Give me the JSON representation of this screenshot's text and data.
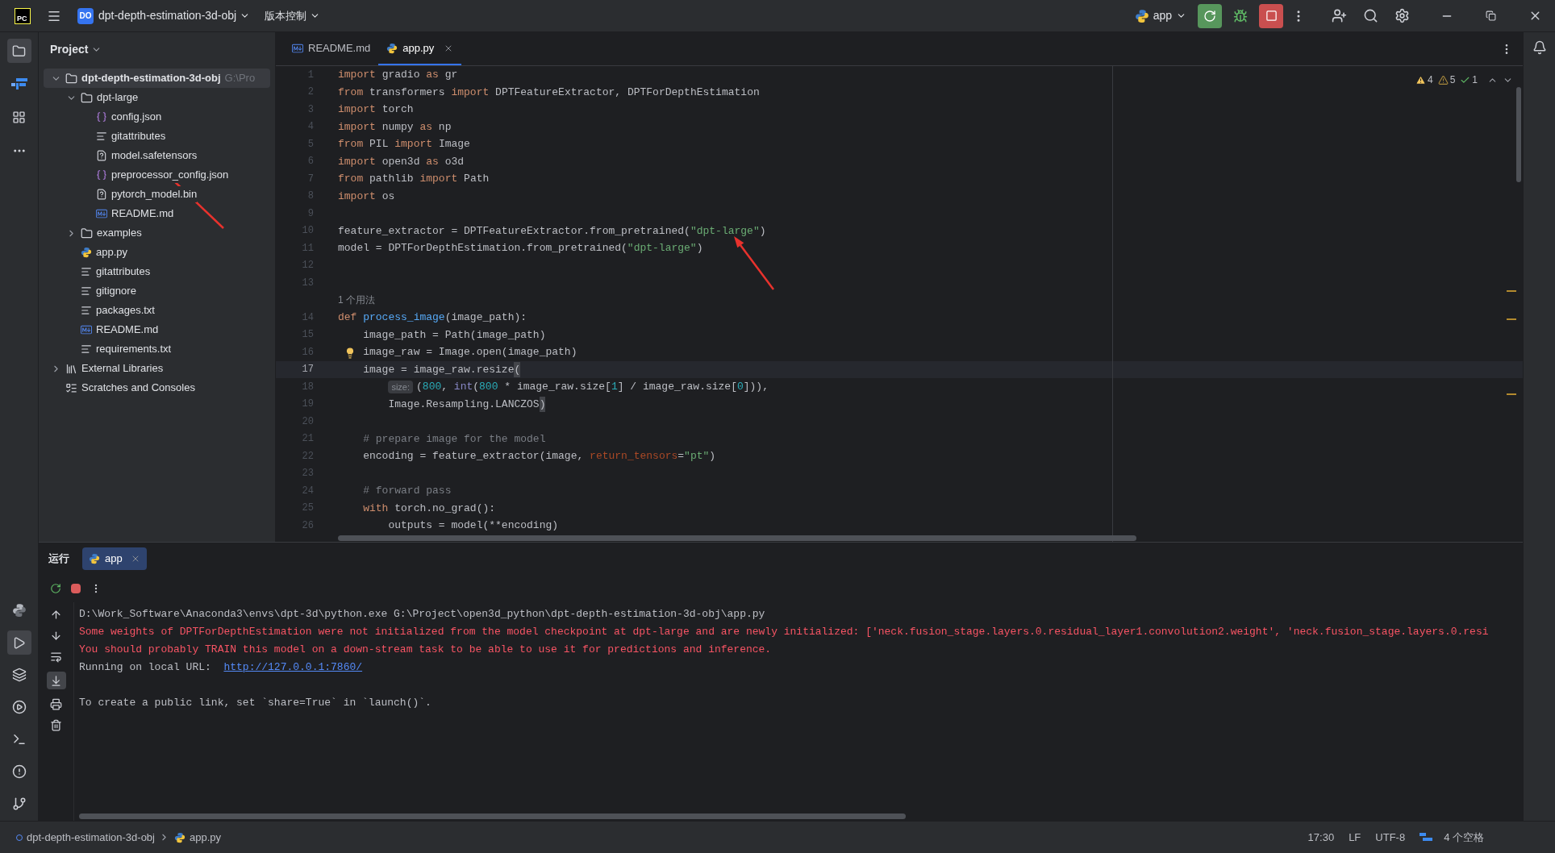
{
  "title_bar": {
    "logo": "PC",
    "project_badge": "DO",
    "project": "dpt-depth-estimation-3d-obj",
    "vcs": "版本控制",
    "run_config": "app"
  },
  "project_panel": {
    "title": "Project",
    "tree": [
      {
        "kind": "folder",
        "name": "dpt-depth-estimation-3d-obj",
        "path": "G:\\Pro",
        "expanded": true,
        "selected": true,
        "children": [
          {
            "kind": "folder",
            "name": "dpt-large",
            "expanded": true,
            "selected": false,
            "children": [
              {
                "kind": "json",
                "name": "config.json",
                "selected": false
              },
              {
                "kind": "text",
                "name": "gitattributes",
                "selected": false
              },
              {
                "kind": "unknown",
                "name": "model.safetensors",
                "selected": false
              },
              {
                "kind": "json",
                "name": "preprocessor_config.json",
                "selected": false
              },
              {
                "kind": "unknown",
                "name": "pytorch_model.bin",
                "selected": false
              },
              {
                "kind": "markdown",
                "name": "README.md",
                "selected": false
              }
            ]
          },
          {
            "kind": "folder",
            "name": "examples",
            "expanded": false,
            "selected": false
          },
          {
            "kind": "python",
            "name": "app.py",
            "selected": false
          },
          {
            "kind": "text",
            "name": "gitattributes",
            "selected": false
          },
          {
            "kind": "text",
            "name": "gitignore",
            "selected": false
          },
          {
            "kind": "text",
            "name": "packages.txt",
            "selected": false
          },
          {
            "kind": "markdown",
            "name": "README.md",
            "selected": false
          },
          {
            "kind": "text",
            "name": "requirements.txt",
            "selected": false
          }
        ]
      },
      {
        "kind": "libraries",
        "name": "External Libraries",
        "expanded": false,
        "selected": false
      },
      {
        "kind": "scratches",
        "name": "Scratches and Consoles",
        "selected": false
      }
    ]
  },
  "editor": {
    "tabs": [
      {
        "kind": "markdown",
        "label": "README.md",
        "selected": false
      },
      {
        "kind": "python",
        "label": "app.py",
        "selected": true
      }
    ],
    "inspections": [
      {
        "kind": "warning",
        "count": "4"
      },
      {
        "kind": "weak",
        "count": "5"
      },
      {
        "kind": "ok",
        "count": "1"
      }
    ],
    "lines": [
      {
        "kind": "code",
        "number": "1",
        "current": false,
        "tokens": [
          {
            "kind": "kw",
            "text": "import"
          },
          {
            "kind": "plain",
            "text": " gradio "
          },
          {
            "kind": "kw",
            "text": "as"
          },
          {
            "kind": "plain",
            "text": " gr"
          }
        ]
      },
      {
        "kind": "code",
        "number": "2",
        "current": false,
        "tokens": [
          {
            "kind": "kw",
            "text": "from"
          },
          {
            "kind": "plain",
            "text": " transformers "
          },
          {
            "kind": "kw",
            "text": "import"
          },
          {
            "kind": "plain",
            "text": " DPTFeatureExtractor, DPTForDepthEstimation"
          }
        ]
      },
      {
        "kind": "code",
        "number": "3",
        "current": false,
        "tokens": [
          {
            "kind": "kw",
            "text": "import"
          },
          {
            "kind": "plain",
            "text": " torch"
          }
        ]
      },
      {
        "kind": "code",
        "number": "4",
        "current": false,
        "tokens": [
          {
            "kind": "kw",
            "text": "import"
          },
          {
            "kind": "plain",
            "text": " numpy "
          },
          {
            "kind": "kw",
            "text": "as"
          },
          {
            "kind": "plain",
            "text": " np"
          }
        ]
      },
      {
        "kind": "code",
        "number": "5",
        "current": false,
        "tokens": [
          {
            "kind": "kw",
            "text": "from"
          },
          {
            "kind": "plain",
            "text": " PIL "
          },
          {
            "kind": "kw",
            "text": "import"
          },
          {
            "kind": "plain",
            "text": " Image"
          }
        ]
      },
      {
        "kind": "code",
        "number": "6",
        "current": false,
        "tokens": [
          {
            "kind": "kw",
            "text": "import"
          },
          {
            "kind": "plain",
            "text": " open3d "
          },
          {
            "kind": "kw",
            "text": "as"
          },
          {
            "kind": "plain",
            "text": " o3d"
          }
        ]
      },
      {
        "kind": "code",
        "number": "7",
        "current": false,
        "tokens": [
          {
            "kind": "kw",
            "text": "from"
          },
          {
            "kind": "plain",
            "text": " pathlib "
          },
          {
            "kind": "kw",
            "text": "import"
          },
          {
            "kind": "plain",
            "text": " Path"
          }
        ]
      },
      {
        "kind": "code",
        "number": "8",
        "current": false,
        "tokens": [
          {
            "kind": "kw",
            "text": "import"
          },
          {
            "kind": "plain",
            "text": " os"
          }
        ]
      },
      {
        "kind": "code",
        "number": "9",
        "current": false
      },
      {
        "kind": "code",
        "number": "10",
        "current": false,
        "tokens": [
          {
            "kind": "plain",
            "text": "feature_extractor = DPTFeatureExtractor.from_pretrained("
          },
          {
            "kind": "str",
            "text": "\"dpt-large\""
          },
          {
            "kind": "plain",
            "text": ")"
          }
        ]
      },
      {
        "kind": "code",
        "number": "11",
        "current": false,
        "tokens": [
          {
            "kind": "plain",
            "text": "model = DPTForDepthEstimation.from_pretrained("
          },
          {
            "kind": "str",
            "text": "\"dpt-large\""
          },
          {
            "kind": "plain",
            "text": ")"
          }
        ]
      },
      {
        "kind": "code",
        "number": "12",
        "current": false
      },
      {
        "kind": "code",
        "number": "13",
        "current": false
      },
      {
        "kind": "usage",
        "text": "1 个用法"
      },
      {
        "kind": "code",
        "number": "14",
        "current": false,
        "tokens": [
          {
            "kind": "kw",
            "text": "def "
          },
          {
            "kind": "fn",
            "text": "process_image"
          },
          {
            "kind": "plain",
            "text": "(image_path):"
          }
        ]
      },
      {
        "kind": "code",
        "number": "15",
        "current": false,
        "tokens": [
          {
            "kind": "plain",
            "text": "    image_path = Path(image_path)"
          }
        ]
      },
      {
        "kind": "code",
        "number": "16",
        "current": false,
        "bulb": true,
        "tokens": [
          {
            "kind": "plain",
            "text": "    image_raw = Image.open(image_path)"
          }
        ]
      },
      {
        "kind": "code",
        "number": "17",
        "current": true,
        "tokens": [
          {
            "kind": "plain",
            "text": "    image = image_raw.resize"
          },
          {
            "kind": "match",
            "text": "("
          }
        ]
      },
      {
        "kind": "code",
        "number": "18",
        "current": false,
        "tokens": [
          {
            "kind": "hint",
            "text": "size:"
          },
          {
            "kind": "plain",
            "text": "("
          },
          {
            "kind": "num",
            "text": "800"
          },
          {
            "kind": "plain",
            "text": ", "
          },
          {
            "kind": "builtin",
            "text": "int"
          },
          {
            "kind": "plain",
            "text": "("
          },
          {
            "kind": "num",
            "text": "800"
          },
          {
            "kind": "plain",
            "text": " * image_raw.size["
          },
          {
            "kind": "num",
            "text": "1"
          },
          {
            "kind": "plain",
            "text": "] / image_raw.size["
          },
          {
            "kind": "num",
            "text": "0"
          },
          {
            "kind": "plain",
            "text": "])),"
          }
        ]
      },
      {
        "kind": "code",
        "number": "19",
        "current": false,
        "tokens": [
          {
            "kind": "plain",
            "text": "        Image.Resampling.LANCZOS"
          },
          {
            "kind": "match",
            "text": ")"
          }
        ]
      },
      {
        "kind": "code",
        "number": "20",
        "current": false
      },
      {
        "kind": "code",
        "number": "21",
        "current": false,
        "tokens": [
          {
            "kind": "comment",
            "text": "    # prepare image for the model"
          }
        ]
      },
      {
        "kind": "code",
        "number": "22",
        "current": false,
        "tokens": [
          {
            "kind": "plain",
            "text": "    encoding = feature_extractor(image, "
          },
          {
            "kind": "param",
            "text": "return_tensors"
          },
          {
            "kind": "plain",
            "text": "="
          },
          {
            "kind": "str",
            "text": "\"pt\""
          },
          {
            "kind": "plain",
            "text": ")"
          }
        ]
      },
      {
        "kind": "code",
        "number": "23",
        "current": false
      },
      {
        "kind": "code",
        "number": "24",
        "current": false,
        "tokens": [
          {
            "kind": "comment",
            "text": "    # forward pass"
          }
        ]
      },
      {
        "kind": "code",
        "number": "25",
        "current": false,
        "tokens": [
          {
            "kind": "kw",
            "text": "    with"
          },
          {
            "kind": "plain",
            "text": " torch.no_grad():"
          }
        ]
      },
      {
        "kind": "code",
        "number": "26",
        "current": false,
        "tokens": [
          {
            "kind": "plain",
            "text": "        outputs = model(**encoding)"
          }
        ]
      }
    ]
  },
  "run_panel": {
    "title": "运行",
    "tabs": [
      {
        "label": "app",
        "selected": true
      }
    ],
    "output_blocks": [
      [
        {
          "kind": "plain",
          "text": "D:\\Work_Software\\Anaconda3\\envs\\dpt-3d\\python.exe G:\\Project\\open3d_python\\dpt-depth-estimation-3d-obj\\app.py"
        },
        {
          "kind": "error",
          "text": "Some weights of DPTForDepthEstimation were not initialized from the model checkpoint at dpt-large and are newly initialized: ['neck.fusion_stage.layers.0.residual_layer1.convolution2.weight', 'neck.fusion_stage.layers.0.resi"
        },
        {
          "kind": "error",
          "text": "You should probably TRAIN this model on a down-stream task to be able to use it for predictions and inference."
        },
        {
          "kind": "plain",
          "text": "Running on local URL:  ",
          "link": "http://127.0.0.1:7860/"
        }
      ],
      [
        {
          "kind": "plain",
          "text": "To create a public link, set `share=True` in `launch()`."
        }
      ]
    ]
  },
  "status_bar": {
    "breadcrumbs": [
      {
        "kind": "project",
        "label": "dpt-depth-estimation-3d-obj"
      },
      {
        "kind": "python",
        "label": "app.py"
      }
    ],
    "items": [
      "17:30",
      "LF",
      "UTF-8",
      "4 个空格"
    ]
  }
}
